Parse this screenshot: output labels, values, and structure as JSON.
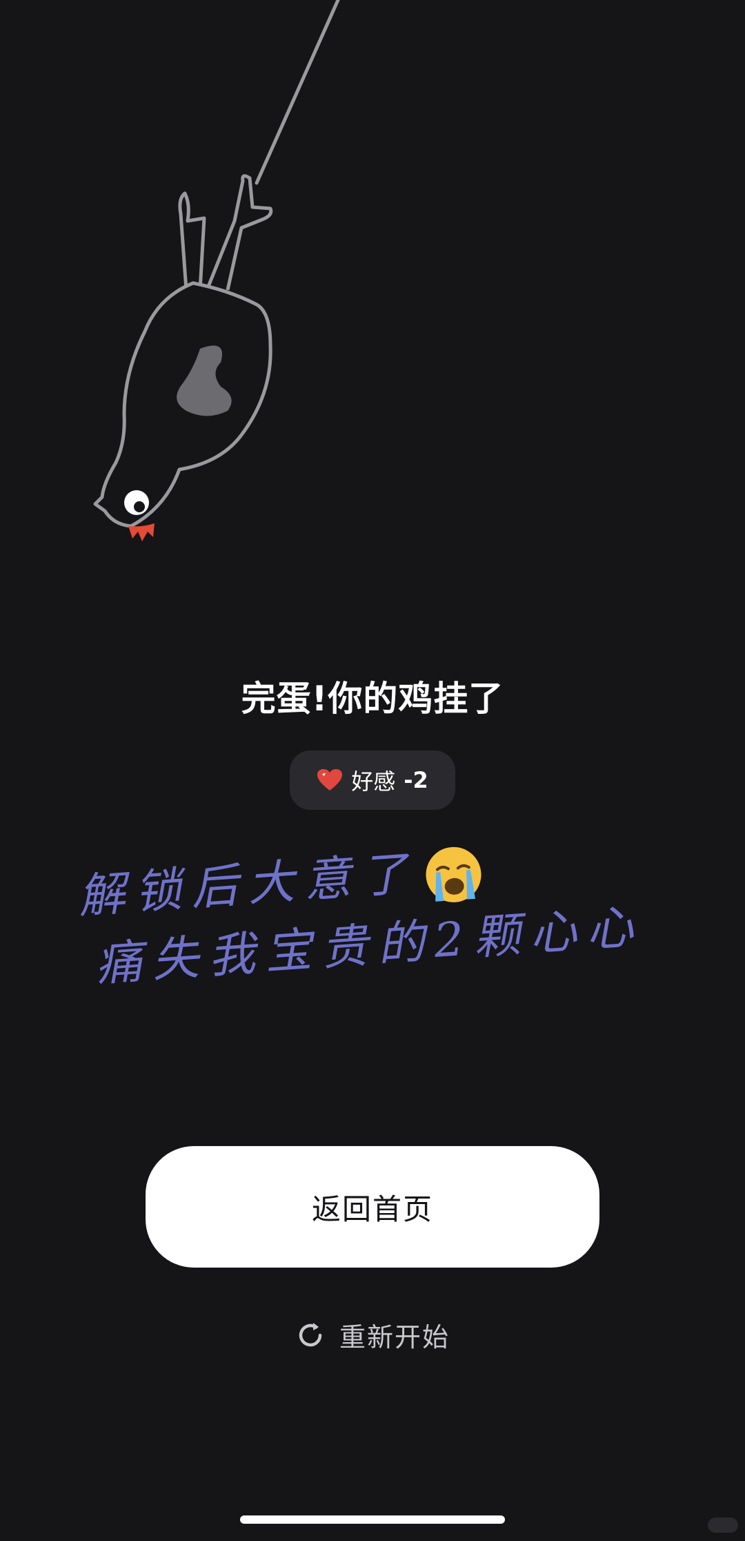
{
  "result": {
    "title": "完蛋!你的鸡挂了"
  },
  "affinity": {
    "label": "好感",
    "value": "-2",
    "heart_color": "#e2473f"
  },
  "handwritten_note": {
    "line1": "解锁后大意了",
    "line2": "痛失我宝贵的2颗心心",
    "emoji": "loudly-crying-face",
    "color": "#6f72c9"
  },
  "actions": {
    "home_label": "返回首页",
    "restart_label": "重新开始",
    "restart_icon": "refresh-icon"
  },
  "illustration": {
    "subject": "hanging-chicken",
    "stroke_color": "#9a9a9e",
    "body_color": "#151417",
    "wing_color": "#6b6b70",
    "comb_color": "#e24b36"
  }
}
